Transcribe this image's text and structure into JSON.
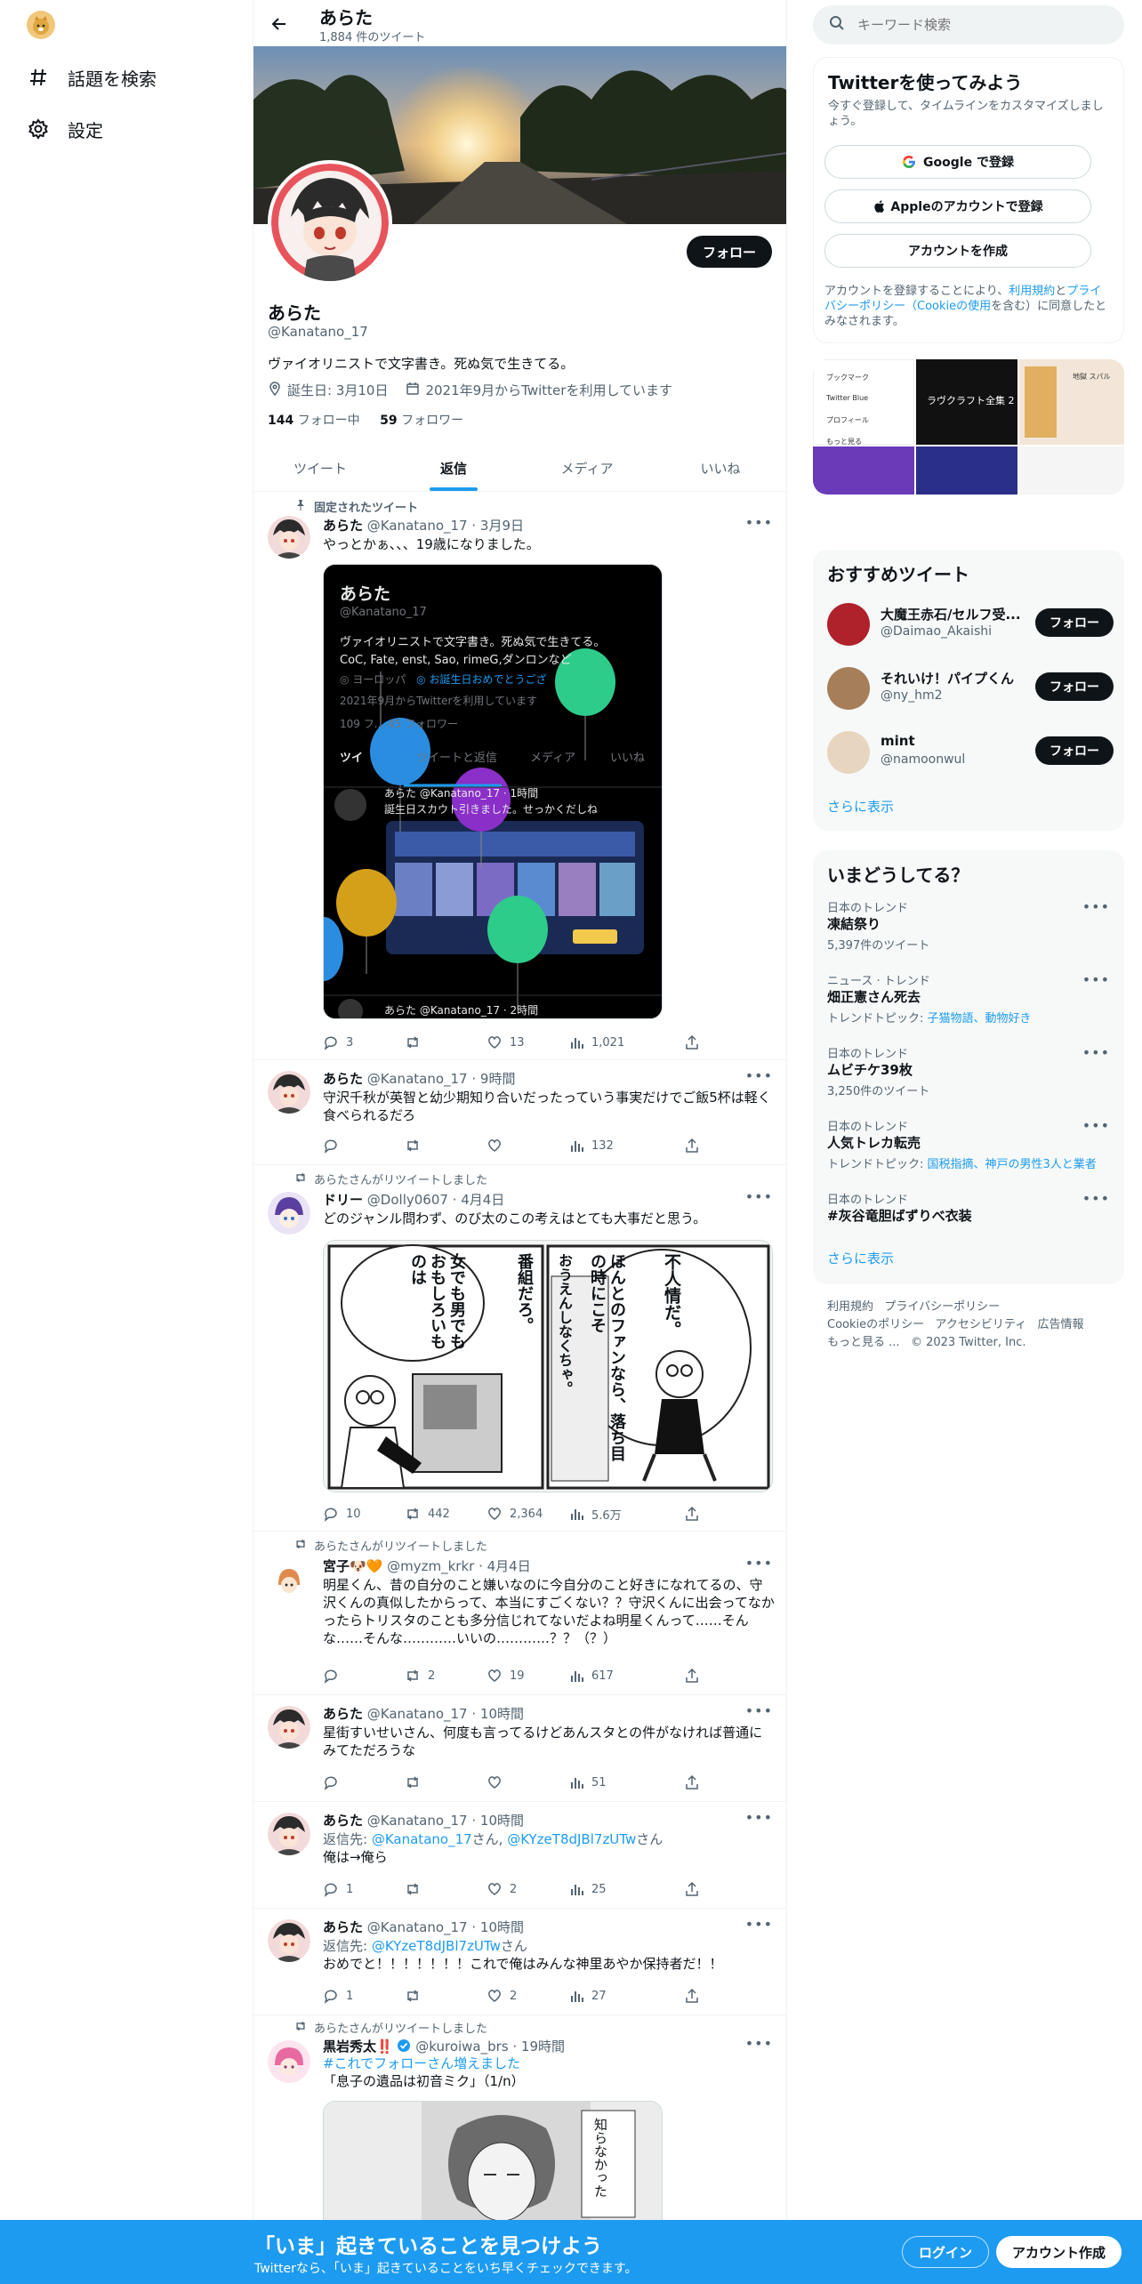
{
  "nav": {
    "explore": "話題を検索",
    "settings": "設定"
  },
  "header": {
    "name": "あらた",
    "tweet_count": "1,884 件のツイート"
  },
  "profile": {
    "name": "あらた",
    "handle": "@Kanatano_17",
    "follow": "フォロー",
    "bio": "ヴァイオリニストで文字書き。死ぬ気で生きてる。",
    "birthday": "誕生日: 3月10日",
    "joined": "2021年9月からTwitterを利用しています",
    "following_count": "144",
    "following_label": "フォロー中",
    "followers_count": "59",
    "followers_label": "フォロワー"
  },
  "tabs": [
    "ツイート",
    "返信",
    "メディア",
    "いいね"
  ],
  "tweets": [
    {
      "context": "固定されたツイート",
      "name": "あらた",
      "meta": "@Kanatano_17 · 3月9日",
      "text": "やっとかぁ、、、19歳になりました。",
      "reply": "3",
      "retweet": "",
      "like": "13",
      "views": "1,021",
      "embed": {
        "name": "あらた",
        "handle": "@Kanatano_17",
        "bio": "ヴァイオリニストで文字書き。死ぬ気で生きてる。",
        "bio2": "CoC, Fate, enst, Sao, rimeG,ダンロンなど",
        "loc": "ヨーロッパ",
        "bday": "お誕生日おめでとうござ",
        "joined": "2021年9月からTwitterを利用しています",
        "stats": "109 フ...  45 フォロワー",
        "tab1": "ツイ",
        "tab2": "ツイートと返信",
        "tab3": "メディア",
        "tab4": "いいね",
        "inner_name": "あらた @Kanatano_17 · 1時間",
        "inner_text": "誕生日スカウト引きました。せっかくだしね",
        "inner2": "あらた @Kanatano_17 · 2時間"
      }
    },
    {
      "context": "",
      "name": "あらた",
      "meta": "@Kanatano_17 · 9時間",
      "text": "守沢千秋が英智と幼少期知り合いだったっていう事実だけでご飯5杯は軽く食べられるだろ",
      "reply": "",
      "retweet": "",
      "like": "",
      "views": "132"
    },
    {
      "context": "あらたさんがリツイートしました",
      "name": "ドリー",
      "meta": "@Dolly0607 · 4月4日",
      "text": "どのジャンル問わず、のび太のこの考えはとても大事だと思う。",
      "reply": "10",
      "retweet": "442",
      "like": "2,364",
      "views": "5.6万",
      "manga": {
        "p1": "不人情だ。",
        "p2": "ほんとのファンなら、落ち目の時にこそ",
        "p3": "おうえんしなくちゃ。",
        "p4": "番組だろ。",
        "p5": "女でも男でもおもしろいものは"
      }
    },
    {
      "context": "あらたさんがリツイートしました",
      "name": "宮子🐶🧡",
      "meta": "@myzm_krkr · 4月4日",
      "text": "明星くん、昔の自分のこと嫌いなのに今自分のこと好きになれてるの、守沢くんの真似したからって、本当にすごくない？？守沢くんに出会ってなかったらトリスタのことも多分信じれてないだよね明星くんって……そんな……そんな…………いいの…………？？（？）",
      "reply": "",
      "retweet": "2",
      "like": "19",
      "views": "617"
    },
    {
      "context": "",
      "name": "あらた",
      "meta": "@Kanatano_17 · 10時間",
      "text": "星街すいせいさん、何度も言ってるけどあんスタとの件がなければ普通にみてただろうな",
      "reply": "",
      "retweet": "",
      "like": "",
      "views": "51"
    },
    {
      "context": "",
      "name": "あらた",
      "meta": "@Kanatano_17 · 10時間",
      "reply_to_label": "返信先:",
      "reply_to": "@Kanatano_17",
      "reply_to_sep": "さん,",
      "reply_to2": "@KYzeT8dJBl7zUTw",
      "reply_to_suffix": "さん",
      "text": "俺は→俺ら",
      "reply": "1",
      "retweet": "",
      "like": "2",
      "views": "25"
    },
    {
      "context": "",
      "name": "あらた",
      "meta": "@Kanatano_17 · 10時間",
      "reply_to_label": "返信先:",
      "reply_to": "@KYzeT8dJBl7zUTw",
      "reply_to_suffix": "さん",
      "text": "おめでと！！！！！！！これで俺はみんな神里あやか保持者だ！！",
      "reply": "1",
      "retweet": "",
      "like": "2",
      "views": "27"
    },
    {
      "context": "あらたさんがリツイートしました",
      "name": "黒岩秀太‼️",
      "meta": "@kuroiwa_brs · 19時間",
      "hashtag": "#これでフォローさん増えました",
      "text": "「息子の遺品は初音ミク」（1/n）",
      "manga_text": "知らなかった"
    }
  ],
  "right": {
    "search_placeholder": "キーワード検索",
    "signup": {
      "title": "Twitterを使ってみよう",
      "sub": "今すぐ登録して、タイムラインをカスタマイズしましょう。",
      "google": "Google で登録",
      "apple": "Appleのアカウントで登録",
      "create": "アカウントを作成",
      "terms1": "アカウントを登録することにより、",
      "terms_link1": "利用規約",
      "terms2": "と",
      "terms_link2": "プライバシーポリシー（Cookieの使用",
      "terms3": "を含む）に同意したとみなされます。"
    },
    "thumbs": {
      "menu1": "ブックマーク",
      "menu2": "Twitter Blue",
      "menu3": "プロフィール",
      "menu4": "もっと見る",
      "t2": "ラヴクラフト全集 2",
      "t3": "地獄 スパル"
    },
    "recommended": {
      "title": "おすすめツイート",
      "items": [
        {
          "name": "大魔王赤石/セルフ受...",
          "handle": "@Daimao_Akaishi",
          "btn": "フォロー"
        },
        {
          "name": "それいけ！パイプくん",
          "handle": "@ny_hm2",
          "btn": "フォロー"
        },
        {
          "name": "mint",
          "handle": "@namoonwul",
          "btn": "フォロー"
        }
      ],
      "more": "さらに表示"
    },
    "trends": {
      "title": "いまどうしてる？",
      "items": [
        {
          "kind": "日本のトレンド",
          "name": "凍結祭り",
          "count": "5,397件のツイート"
        },
        {
          "kind": "ニュース · トレンド",
          "name": "畑正憲さん死去",
          "count": "トレンドトピック: ",
          "links": "子猫物語、動物好き"
        },
        {
          "kind": "日本のトレンド",
          "name": "ムビチケ39枚",
          "count": "3,250件のツイート"
        },
        {
          "kind": "日本のトレンド",
          "name": "人気トレカ転売",
          "count": "トレンドトピック: ",
          "links": "国税指摘、神戸の男性3人と業者"
        },
        {
          "kind": "日本のトレンド",
          "name": "#灰谷竜胆ばずりべ衣装",
          "count": ""
        }
      ],
      "more": "さらに表示"
    },
    "footer": {
      "l1a": "利用規約",
      "l1b": "プライバシーポリシー",
      "l2a": "Cookieのポリシー",
      "l2b": "アクセシビリティ",
      "l2c": "広告情報",
      "l3a": "もっと見る ...",
      "l3b": "© 2023 Twitter, Inc."
    }
  },
  "bottom": {
    "title": "「いま」起きていることを見つけよう",
    "sub": "Twitterなら、「いま」起きていることをいち早くチェックできます。",
    "login": "ログイン",
    "signup": "アカウント作成"
  },
  "colors": {
    "accent": "#1d9bf0",
    "dark": "#0f1419",
    "muted": "#536471"
  }
}
